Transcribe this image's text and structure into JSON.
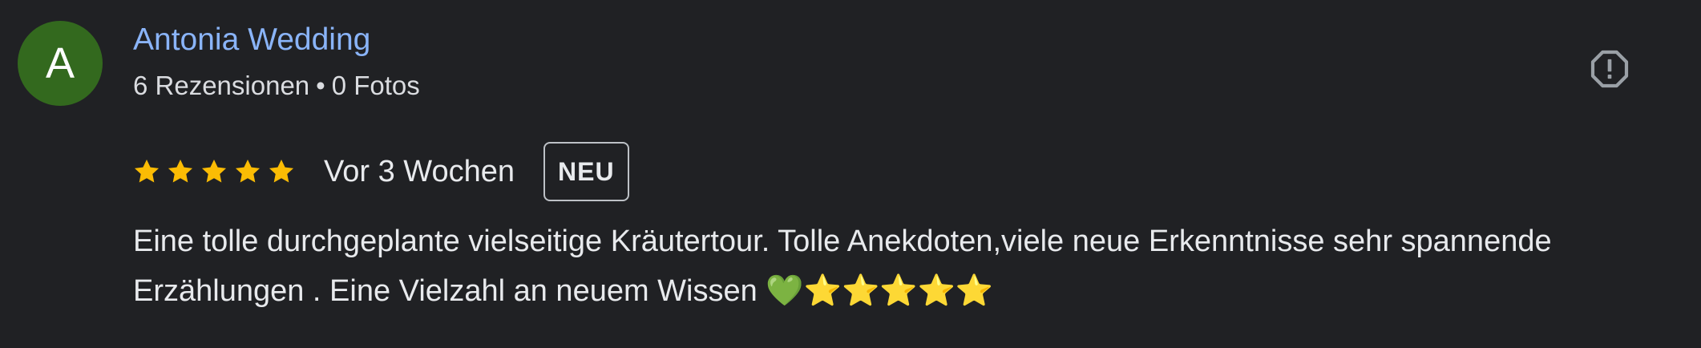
{
  "review": {
    "avatar_letter": "A",
    "author_name": "Antonia Wedding",
    "reviews_count": "6 Rezensionen",
    "separator": "•",
    "photos_count": "0 Fotos",
    "rating": 5,
    "rating_max": 5,
    "time_ago": "Vor 3 Wochen",
    "badge": "NEU",
    "text": "Eine tolle durchgeplante vielseitige Kräutertour. Tolle Anekdoten,viele neue Erkenntnisse sehr spannende Erzählungen . Eine Vielzahl an neuem Wissen 💚⭐⭐⭐⭐⭐",
    "icons": {
      "star": "star-icon",
      "report": "report-flag-icon"
    },
    "colors": {
      "avatar_bg": "#33691e",
      "author_name": "#8ab4f8",
      "star": "#fbbc04",
      "background": "#202124"
    }
  }
}
